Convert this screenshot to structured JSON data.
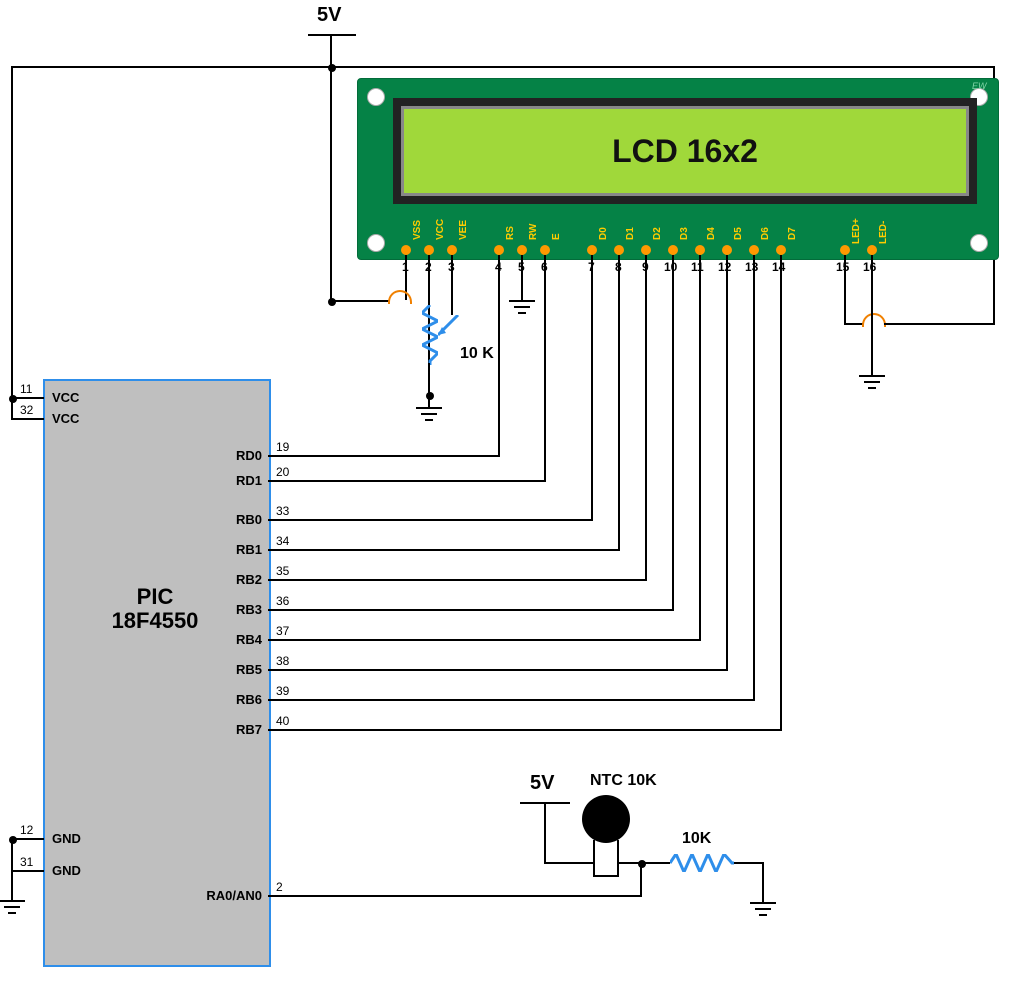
{
  "power": {
    "top_rail": "5V",
    "sensor_rail": "5V"
  },
  "lcd": {
    "title": "LCD 16x2",
    "watermark": "EW",
    "pins": [
      {
        "n": 1,
        "name": "VSS"
      },
      {
        "n": 2,
        "name": "VCC"
      },
      {
        "n": 3,
        "name": "VEE"
      },
      {
        "n": 4,
        "name": "RS"
      },
      {
        "n": 5,
        "name": "RW"
      },
      {
        "n": 6,
        "name": "E"
      },
      {
        "n": 7,
        "name": "D0"
      },
      {
        "n": 8,
        "name": "D1"
      },
      {
        "n": 9,
        "name": "D2"
      },
      {
        "n": 10,
        "name": "D3"
      },
      {
        "n": 11,
        "name": "D4"
      },
      {
        "n": 12,
        "name": "D5"
      },
      {
        "n": 13,
        "name": "D6"
      },
      {
        "n": 14,
        "name": "D7"
      },
      {
        "n": 15,
        "name": "LED+"
      },
      {
        "n": 16,
        "name": "LED-"
      }
    ]
  },
  "potentiometer": {
    "value": "10 K"
  },
  "resistor": {
    "value": "10K"
  },
  "thermistor": {
    "label": "NTC 10K"
  },
  "mcu": {
    "title1": "PIC",
    "title2": "18F4550",
    "left_pins": [
      {
        "num": "11",
        "label": "VCC"
      },
      {
        "num": "32",
        "label": "VCC"
      },
      {
        "num": "12",
        "label": "GND"
      },
      {
        "num": "31",
        "label": "GND"
      }
    ],
    "right_pins": [
      {
        "num": "19",
        "label": "RD0"
      },
      {
        "num": "20",
        "label": "RD1"
      },
      {
        "num": "33",
        "label": "RB0"
      },
      {
        "num": "34",
        "label": "RB1"
      },
      {
        "num": "35",
        "label": "RB2"
      },
      {
        "num": "36",
        "label": "RB3"
      },
      {
        "num": "37",
        "label": "RB4"
      },
      {
        "num": "38",
        "label": "RB5"
      },
      {
        "num": "39",
        "label": "RB6"
      },
      {
        "num": "40",
        "label": "RB7"
      },
      {
        "num": "2",
        "label": "RA0/AN0"
      }
    ]
  }
}
